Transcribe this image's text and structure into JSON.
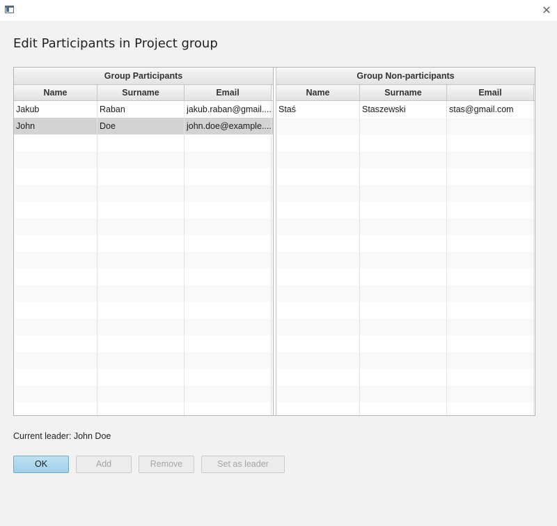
{
  "dialog": {
    "title": "Edit Participants in Project group"
  },
  "participants": {
    "group_header": "Group Participants",
    "columns": [
      "Name",
      "Surname",
      "Email"
    ],
    "rows": [
      [
        "Jakub",
        "Raban",
        "jakub.raban@gmail...."
      ],
      [
        "John",
        "Doe",
        "john.doe@example...."
      ]
    ],
    "selected_row": 1
  },
  "non_participants": {
    "group_header": "Group Non-participants",
    "columns": [
      "Name",
      "Surname",
      "Email"
    ],
    "rows": [
      [
        "Staś",
        "Staszewski",
        "stas@gmail.com"
      ]
    ]
  },
  "leader": {
    "label": "Current leader: John Doe"
  },
  "buttons": {
    "ok": "OK",
    "add": "Add",
    "remove": "Remove",
    "set_leader": "Set as leader"
  },
  "icons": {
    "window": "app-window-icon",
    "close": "close-icon"
  }
}
